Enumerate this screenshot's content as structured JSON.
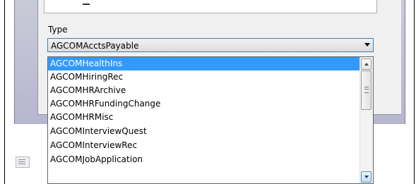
{
  "type_field": {
    "label": "Type",
    "selected_value": "AGCOMAcctsPayable"
  },
  "dropdown": {
    "items": [
      "AGCOMHealthIns",
      "AGCOMHiringRec",
      "AGCOMHRArchive",
      "AGCOMHRFundingChange",
      "AGCOMHRMisc",
      "AGCOMInterviewQuest",
      "AGCOMInterviewRec",
      "AGCOMJobApplication"
    ],
    "highlighted_index": 0
  },
  "colors": {
    "highlight": "#3399ff",
    "combo_border": "#3c7fb1",
    "dialog_frame": "#b6b6cf"
  }
}
